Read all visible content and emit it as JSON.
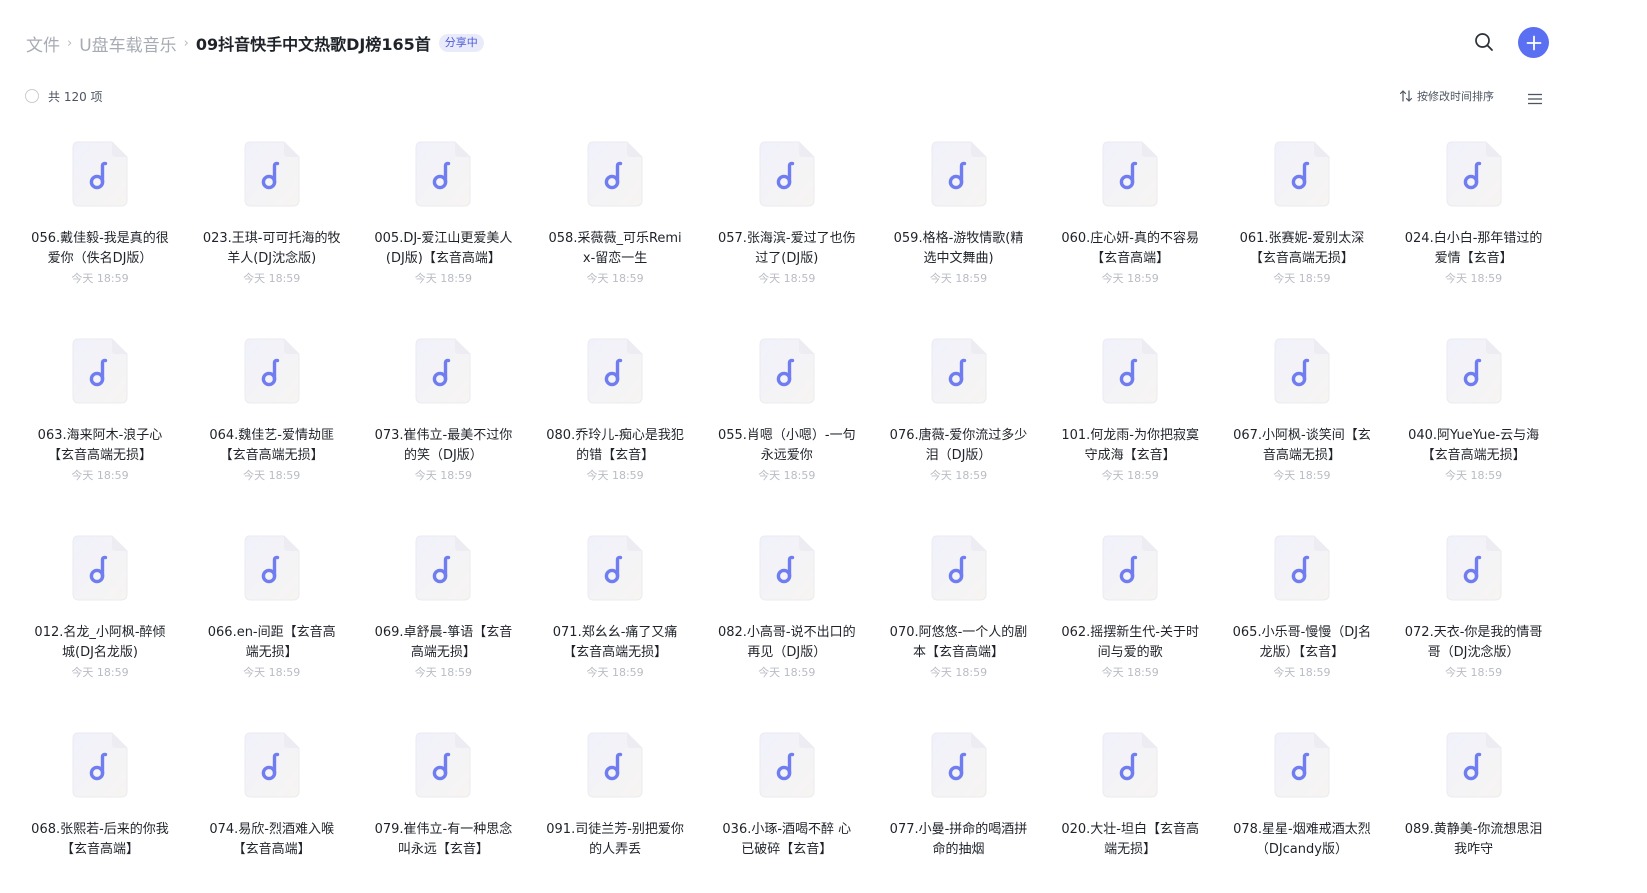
{
  "breadcrumb": {
    "items": [
      "文件",
      "U盘车载音乐"
    ],
    "current": "09抖音快手中文热歌DJ榜165首",
    "badge": "分享中"
  },
  "header": {
    "search_icon": "search-icon",
    "add_icon": "plus-icon"
  },
  "colors": {
    "accent": "#5b6ff2",
    "icon_note": "#6f7df0",
    "icon_bg": "#f7f5f2"
  },
  "toolbar": {
    "count_label": "共 120 项",
    "sort_label": "按修改时间排序",
    "sort_icon": "sort-arrows-icon",
    "view_icon": "list-view-icon"
  },
  "files": [
    {
      "name": "056.戴佳毅-我是真的很爱你（佚名DJ版）",
      "time": "今天 18:59"
    },
    {
      "name": "023.王琪-可可托海的牧羊人(DJ沈念版)",
      "time": "今天 18:59"
    },
    {
      "name": "005.DJ-爱江山更爱美人(DJ版)【玄音高端】",
      "time": "今天 18:59"
    },
    {
      "name": "058.采薇薇_可乐Remix-留恋一生",
      "time": "今天 18:59"
    },
    {
      "name": "057.张海滨-爱过了也伤过了(DJ版)",
      "time": "今天 18:59"
    },
    {
      "name": "059.格格-游牧情歌(精选中文舞曲)",
      "time": "今天 18:59"
    },
    {
      "name": "060.庄心妍-真的不容易【玄音高端】",
      "time": "今天 18:59"
    },
    {
      "name": "061.张赛妮-爱别太深【玄音高端无损】",
      "time": "今天 18:59"
    },
    {
      "name": "024.白小白-那年错过的爱情【玄音】",
      "time": "今天 18:59"
    },
    {
      "name": "063.海来阿木-浪子心【玄音高端无损】",
      "time": "今天 18:59"
    },
    {
      "name": "064.魏佳艺-爱情劫匪【玄音高端无损】",
      "time": "今天 18:59"
    },
    {
      "name": "073.崔伟立-最美不过你的笑（DJ版）",
      "time": "今天 18:59"
    },
    {
      "name": "080.乔玲儿-痴心是我犯的错【玄音】",
      "time": "今天 18:59"
    },
    {
      "name": "055.肖嗯（小嗯）-一句永远爱你",
      "time": "今天 18:59"
    },
    {
      "name": "076.唐薇-爱你流过多少泪（DJ版）",
      "time": "今天 18:59"
    },
    {
      "name": "101.何龙雨-为你把寂寞守成海【玄音】",
      "time": "今天 18:59"
    },
    {
      "name": "067.小阿枫-谈笑间【玄音高端无损】",
      "time": "今天 18:59"
    },
    {
      "name": "040.阿YueYue-云与海【玄音高端无损】",
      "time": "今天 18:59"
    },
    {
      "name": "012.名龙_小阿枫-醉倾城(DJ名龙版)",
      "time": "今天 18:59"
    },
    {
      "name": "066.en-间距【玄音高端无损】",
      "time": "今天 18:59"
    },
    {
      "name": "069.卓舒晨-箏语【玄音高端无损】",
      "time": "今天 18:59"
    },
    {
      "name": "071.郑幺幺-痛了又痛【玄音高端无损】",
      "time": "今天 18:59"
    },
    {
      "name": "082.小高哥-说不出口的再见（DJ版）",
      "time": "今天 18:59"
    },
    {
      "name": "070.阿悠悠-一个人的剧本【玄音高端】",
      "time": "今天 18:59"
    },
    {
      "name": "062.摇摆新生代-关于时间与爱的歌",
      "time": "今天 18:59"
    },
    {
      "name": "065.小乐哥-慢慢（DJ名龙版）【玄音】",
      "time": "今天 18:59"
    },
    {
      "name": "072.天衣-你是我的情哥哥（DJ沈念版）",
      "time": "今天 18:59"
    },
    {
      "name": "068.张熙若-后来的你我【玄音高端】",
      "time": ""
    },
    {
      "name": "074.易欣-烈酒难入喉【玄音高端】",
      "time": ""
    },
    {
      "name": "079.崔伟立-有一种思念叫永远【玄音】",
      "time": ""
    },
    {
      "name": "091.司徒兰芳-别把爱你的人弄丢",
      "time": ""
    },
    {
      "name": "036.小琢-酒喝不醉 心已破碎【玄音】",
      "time": ""
    },
    {
      "name": "077.小曼-拼命的喝酒拼命的抽烟",
      "time": ""
    },
    {
      "name": "020.大壮-坦白【玄音高端无损】",
      "time": ""
    },
    {
      "name": "078.星星-烟难戒酒太烈（DJcandy版）",
      "time": ""
    },
    {
      "name": "089.黄静美-你流想思泪 我咋守",
      "time": ""
    }
  ]
}
